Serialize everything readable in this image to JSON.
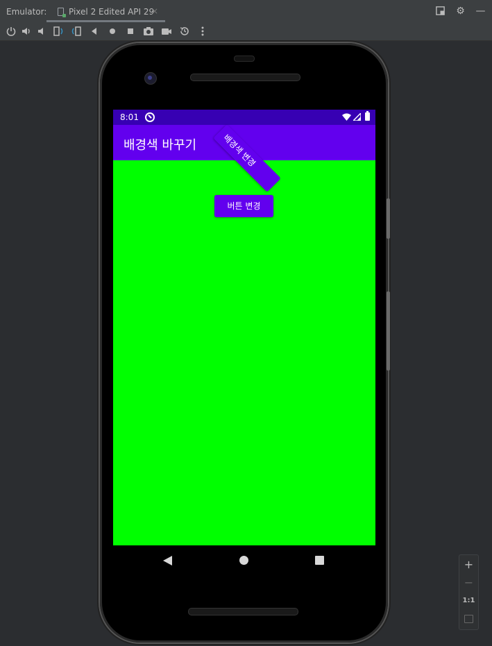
{
  "ide": {
    "emulator_label": "Emulator:",
    "tab_label": "Pixel 2 Edited API 29",
    "tab_close": "×"
  },
  "toolbar": {
    "tools": [
      "power-icon",
      "volume-up-icon",
      "volume-down-icon",
      "rotate-left-icon",
      "rotate-right-icon",
      "back-icon",
      "home-icon",
      "overview-icon",
      "screenshot-icon",
      "screen-record-icon",
      "snapshot-icon",
      "more-icon"
    ]
  },
  "device": {
    "status_time": "8:01",
    "app_title": "배경색 바꾸기",
    "button_change_label": "버튼 변경",
    "button_bg_label": "배경색 변경",
    "screen_bg": "#00ff00",
    "appbar_color": "#6200ee",
    "statusbar_color": "#3700b3"
  },
  "zoom": {
    "zoom_in": "+",
    "zoom_out": "−",
    "one_to_one": "1:1"
  }
}
